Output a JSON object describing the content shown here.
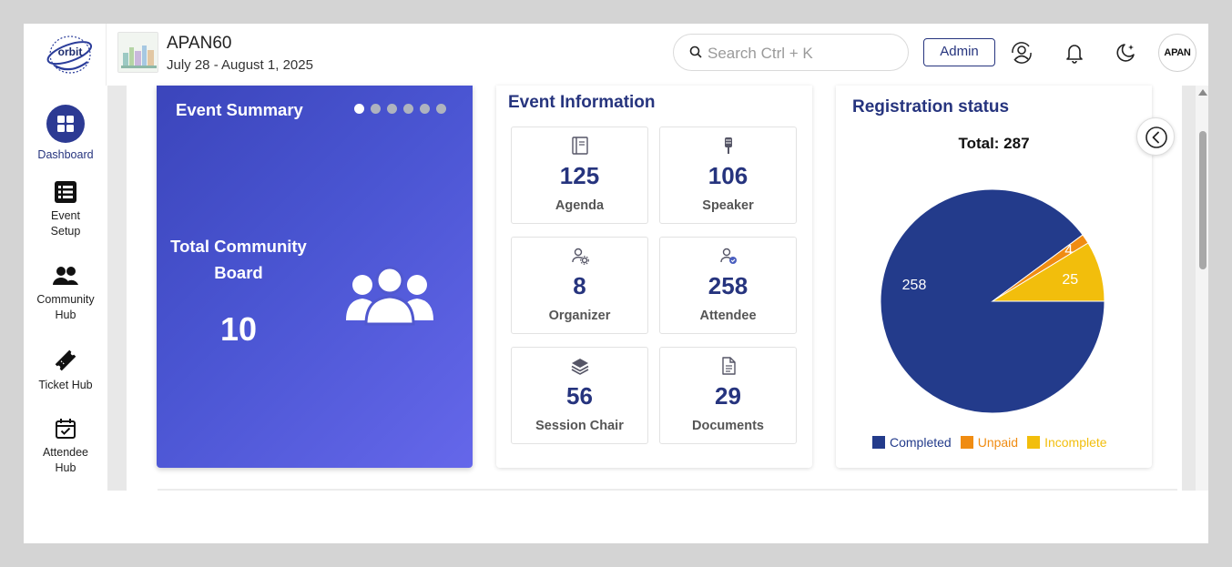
{
  "header": {
    "logo_text": "orbit",
    "event_title": "APAN60",
    "event_dates": "July 28 - August 1, 2025",
    "search_placeholder": "Search  Ctrl + K",
    "admin_label": "Admin",
    "avatar_text": "APAN"
  },
  "sidebar": {
    "items": [
      {
        "label": "Dashboard",
        "icon": "dashboard-icon",
        "active": true
      },
      {
        "label": "Event\nSetup",
        "icon": "list-icon"
      },
      {
        "label": "Community\nHub",
        "icon": "users-icon"
      },
      {
        "label": "Ticket Hub",
        "icon": "ticket-icon"
      },
      {
        "label": "Attendee\nHub",
        "icon": "calendar-check-icon"
      }
    ]
  },
  "summary": {
    "title": "Event Summary",
    "label": "Total Community Board",
    "count": "10",
    "slides": 6,
    "active_slide": 0
  },
  "info": {
    "title": "Event Information",
    "tiles": [
      {
        "value": "125",
        "label": "Agenda",
        "icon": "notebook-icon"
      },
      {
        "value": "106",
        "label": "Speaker",
        "icon": "microphone-icon"
      },
      {
        "value": "8",
        "label": "Organizer",
        "icon": "user-gear-icon"
      },
      {
        "value": "258",
        "label": "Attendee",
        "icon": "user-check-icon"
      },
      {
        "value": "56",
        "label": "Session Chair",
        "icon": "layers-icon"
      },
      {
        "value": "29",
        "label": "Documents",
        "icon": "document-icon"
      }
    ]
  },
  "registration": {
    "title": "Registration status",
    "total_label": "Total: 287"
  },
  "chart_data": {
    "type": "pie",
    "title": "Registration status",
    "total": 287,
    "slices": [
      {
        "label": "Completed",
        "value": 258,
        "color": "#233b8b"
      },
      {
        "label": "Unpaid",
        "value": 4,
        "color": "#f08c12"
      },
      {
        "label": "Incomplete",
        "value": 25,
        "color": "#f2be0c"
      }
    ],
    "legend_position": "bottom"
  },
  "colors": {
    "primary": "#26347e",
    "summary_gradient_start": "#3b45bb",
    "summary_gradient_end": "#6567ea"
  }
}
